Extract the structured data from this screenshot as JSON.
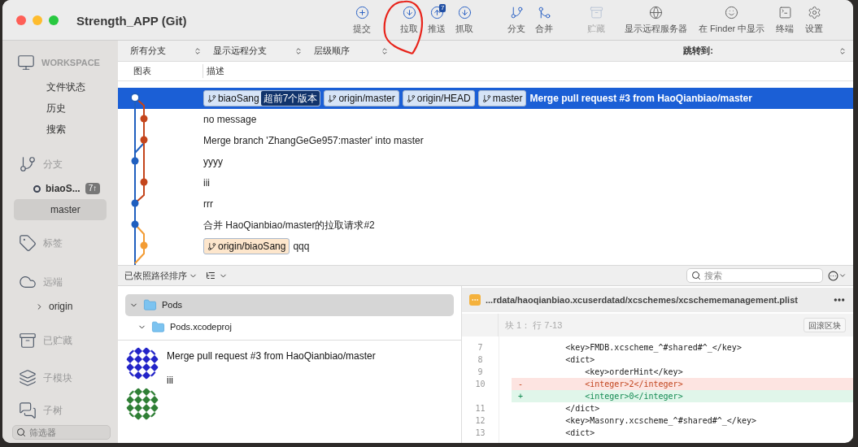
{
  "window": {
    "title": "Strength_APP (Git)"
  },
  "toolbar": [
    {
      "label": "提交",
      "disabled": false
    },
    {
      "label": "拉取",
      "disabled": false
    },
    {
      "label": "推送",
      "disabled": false,
      "badge": "7"
    },
    {
      "label": "抓取",
      "disabled": false
    },
    {
      "label": "分支",
      "disabled": false
    },
    {
      "label": "合并",
      "disabled": false
    },
    {
      "label": "贮藏",
      "disabled": true
    },
    {
      "label": "显示远程服务器",
      "disabled": false
    },
    {
      "label": "在 Finder 中显示",
      "disabled": false
    },
    {
      "label": "终端",
      "disabled": false
    },
    {
      "label": "设置",
      "disabled": false
    }
  ],
  "sidebar": {
    "workspace": {
      "label": "WORKSPACE",
      "items": [
        {
          "label": "文件状态",
          "selected": false
        },
        {
          "label": "历史",
          "selected": false
        },
        {
          "label": "搜索",
          "selected": false
        }
      ]
    },
    "branches": {
      "label": "分支",
      "items": [
        {
          "label": "biaoS...",
          "current": true,
          "badge": "7↑",
          "selected": false
        },
        {
          "label": "master",
          "current": false,
          "selected": true
        }
      ]
    },
    "tags": {
      "label": "标签"
    },
    "remotes": {
      "label": "远端",
      "items": [
        {
          "label": "origin",
          "expanded": false
        }
      ]
    },
    "stashes": {
      "label": "已贮藏"
    },
    "submodules": {
      "label": "子模块"
    },
    "subtrees": {
      "label": "子树"
    },
    "filter": {
      "placeholder": "筛选器"
    }
  },
  "filter_bar": {
    "branches": "所有分支",
    "remotes": "显示远程分支",
    "order": "层级顺序",
    "jump_to": "跳转到:"
  },
  "columns": [
    "图表",
    "描述"
  ],
  "commits": [
    {
      "selected": true,
      "refs": [
        {
          "label": "biaoSang",
          "color": "#d6e4f7",
          "ahead": "超前7个版本"
        },
        {
          "label": "origin/master",
          "color": "#d6e4f7"
        },
        {
          "label": "origin/HEAD",
          "color": "#d6e4f7"
        },
        {
          "label": "master",
          "color": "#d6e4f7"
        }
      ],
      "message": "Merge pull request #3 from HaoQianbiao/master"
    },
    {
      "selected": false,
      "message": "no message"
    },
    {
      "selected": false,
      "message": "Merge branch 'ZhangGeGe957:master' into master"
    },
    {
      "selected": false,
      "message": "yyyy"
    },
    {
      "selected": false,
      "message": "iii"
    },
    {
      "selected": false,
      "message": "rrr"
    },
    {
      "selected": false,
      "message": "合并 HaoQianbiao/master的拉取请求#2"
    },
    {
      "selected": false,
      "refs": [
        {
          "label": "origin/biaoSang",
          "color": "#fde6cc"
        }
      ],
      "message": "qqq"
    }
  ],
  "bottom_bar": {
    "sort": "已依照路径排序",
    "search_placeholder": "搜索"
  },
  "file_tree": [
    {
      "label": "Pods",
      "selected": true,
      "expanded": true,
      "children": [
        {
          "label": "Pods.xcodeproj",
          "selected": false,
          "expanded": true
        }
      ]
    }
  ],
  "commit_detail": {
    "title": "Merge pull request #3 from HaoQianbiao/master",
    "body": "iii"
  },
  "diff": {
    "file": "...rdata/haoqianbiao.xcuserdatad/xcschemes/xcschememanagement.plist",
    "hunk": "块 1： 行 7-13",
    "discard": "回滚区块",
    "lines": [
      {
        "number": "7",
        "kind": "context",
        "text": "        <key>FMDB.xcscheme_^#shared#^_</key>"
      },
      {
        "number": "8",
        "kind": "context",
        "text": "        <dict>"
      },
      {
        "number": "9",
        "kind": "context",
        "text": "            <key>orderHint</key>"
      },
      {
        "number": "10",
        "kind": "removed",
        "sign": "-",
        "text": "            <integer>2</integer>"
      },
      {
        "kind": "added",
        "sign": "+",
        "text": "            <integer>0</integer>"
      },
      {
        "number": "11",
        "kind": "context",
        "text": "        </dict>"
      },
      {
        "number": "12",
        "kind": "context",
        "text": "        <key>Masonry.xcscheme_^#shared#^_</key>"
      },
      {
        "number": "13",
        "kind": "context",
        "text": "        <dict>"
      }
    ]
  }
}
